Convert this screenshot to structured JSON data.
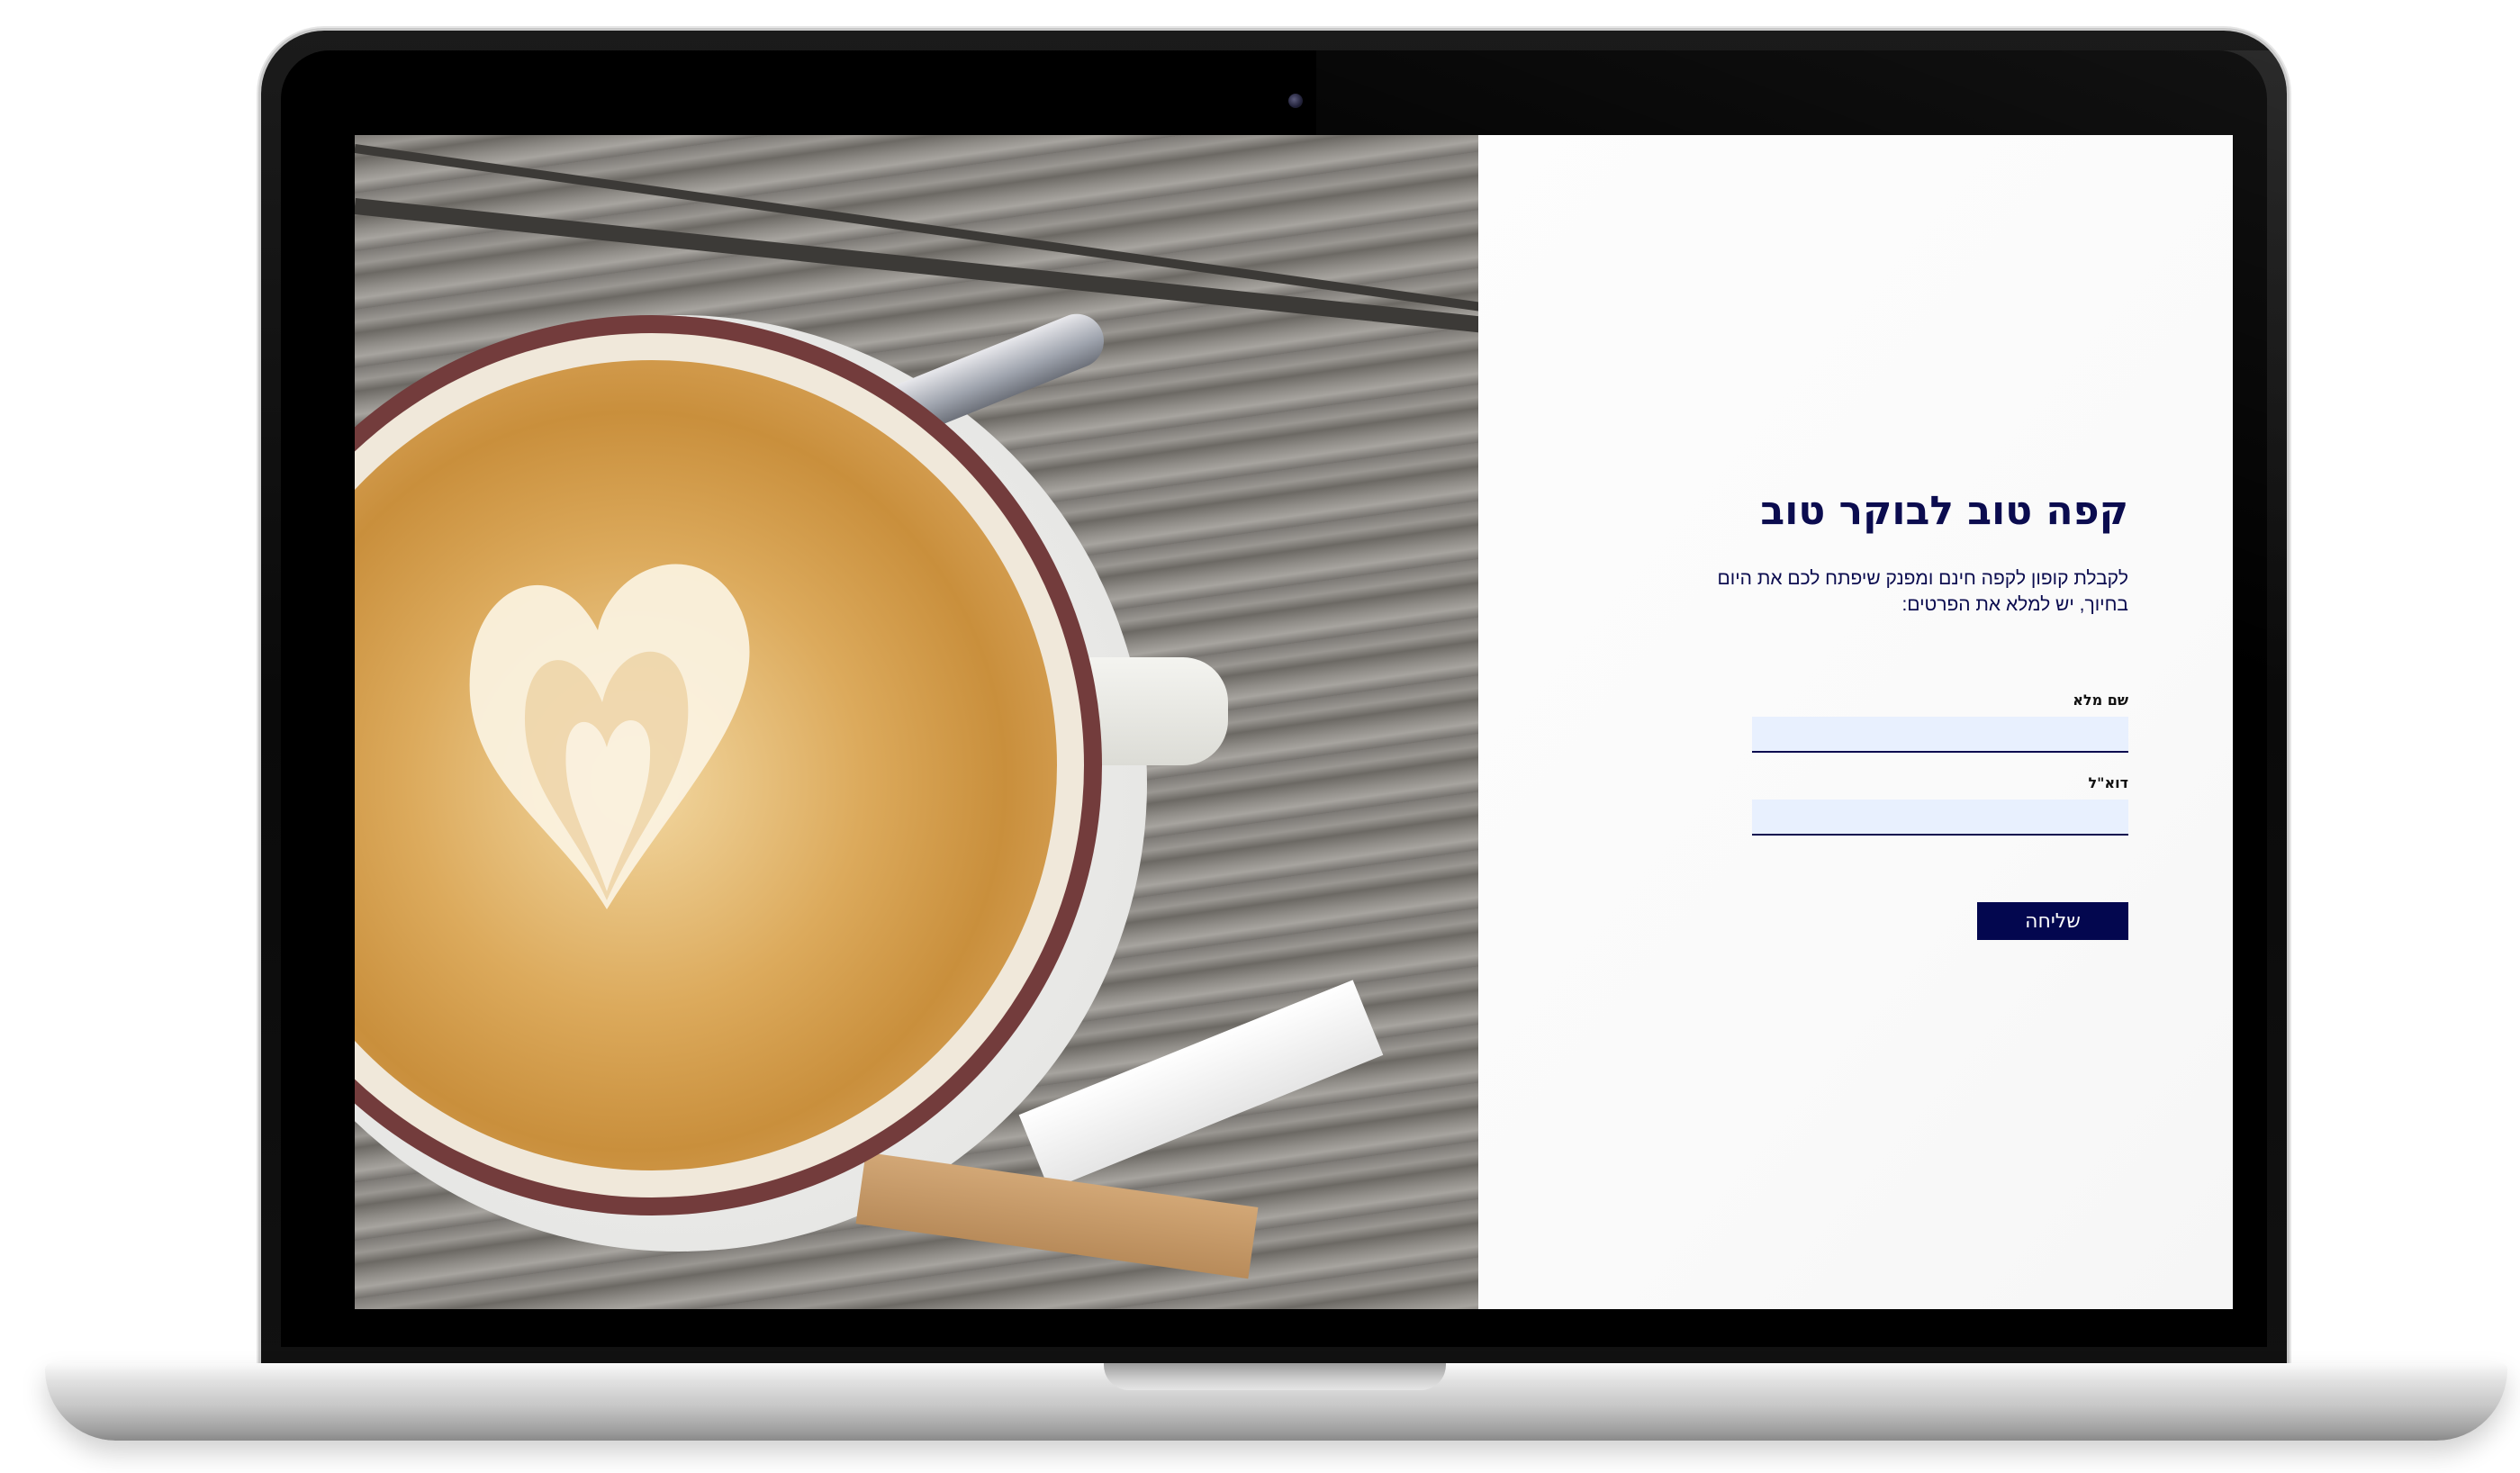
{
  "form": {
    "headline": "קפה טוב לבוקר טוב",
    "subtext_line1": "לקבלת קופון לקפה חינם ומפנק שיפתח לכם את היום",
    "subtext_line2": "בחיוך, יש למלא את הפרטים:",
    "name_label": "שם מלא",
    "name_value": "",
    "email_label": "דוא\"ל",
    "email_value": "",
    "submit_label": "שליחה"
  },
  "photo": {
    "subject": "latte-art-coffee-cup"
  },
  "colors": {
    "brand_navy": "#03074f",
    "headline": "#0b0c4f",
    "input_bg": "#e8f0fe"
  }
}
